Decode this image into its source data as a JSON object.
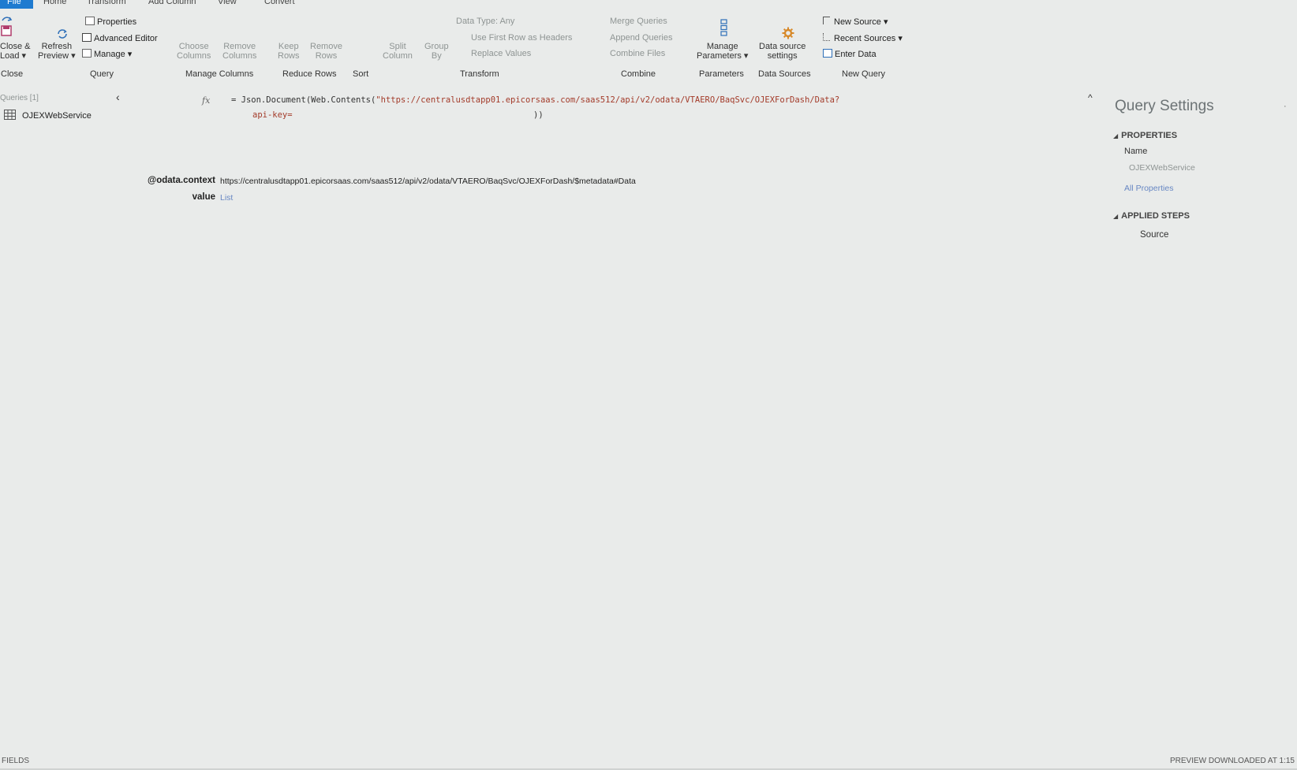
{
  "tabs": [
    "File",
    "Home",
    "Transform",
    "Add Column",
    "View",
    "Convert"
  ],
  "ribbon": {
    "close_load": [
      "Close &",
      "Load ▾"
    ],
    "refresh_preview": [
      "Refresh",
      "Preview ▾"
    ],
    "properties": "Properties",
    "advanced_editor": "Advanced Editor",
    "manage": "Manage ▾",
    "choose_columns": [
      "Choose",
      "Columns"
    ],
    "remove_columns": [
      "Remove",
      "Columns"
    ],
    "keep_rows": [
      "Keep",
      "Rows"
    ],
    "remove_rows": [
      "Remove",
      "Rows"
    ],
    "split_column": [
      "Split",
      "Column"
    ],
    "group_by": [
      "Group",
      "By"
    ],
    "data_type": "Data Type: Any",
    "use_first_row": "Use First Row as Headers",
    "replace_values": "Replace Values",
    "merge_queries": "Merge Queries",
    "append_queries": "Append Queries",
    "combine_files": "Combine Files",
    "manage_parameters": [
      "Manage",
      "Parameters ▾"
    ],
    "data_source_settings": [
      "Data source",
      "settings"
    ],
    "new_source": "New Source ▾",
    "recent_sources": "Recent Sources ▾",
    "enter_data": "Enter Data",
    "groups": {
      "close": "Close",
      "query": "Query",
      "manage_columns": "Manage Columns",
      "reduce_rows": "Reduce Rows",
      "sort": "Sort",
      "transform": "Transform",
      "combine": "Combine",
      "parameters": "Parameters",
      "data_sources": "Data Sources",
      "new_query": "New Query"
    }
  },
  "queries_pane": {
    "header": "Queries [1]",
    "item": "OJEXWebService"
  },
  "formula_bar": {
    "fx": "fx",
    "prefix": "= Json.Document(Web.Contents(",
    "url": "\"https://centralusdtapp01.epicorsaas.com/saas512/api/v2/odata/VTAERO/BaqSvc/OJEXForDash/Data?",
    "api_key": "api-key=",
    "suffix": "))"
  },
  "preview": {
    "rows": [
      {
        "key": "@odata.context",
        "value": "https://centralusdtapp01.epicorsaas.com/saas512/api/v2/odata/VTAERO/BaqSvc/OJEXForDash/$metadata#Data"
      },
      {
        "key": "value",
        "value": "List"
      }
    ]
  },
  "query_settings": {
    "title": "Query Settings",
    "properties_header": "PROPERTIES",
    "name_label": "Name",
    "name_value": "OJEXWebService",
    "all_properties": "All Properties",
    "applied_steps_header": "APPLIED STEPS",
    "steps": [
      "Source"
    ]
  },
  "status_bar": {
    "left": "FIELDS",
    "right": "PREVIEW DOWNLOADED AT 1:15"
  },
  "colors": {
    "accent": "#1f7bd0",
    "background": "#e9ebea",
    "string": "#a33b2a",
    "link": "#6787c3"
  }
}
